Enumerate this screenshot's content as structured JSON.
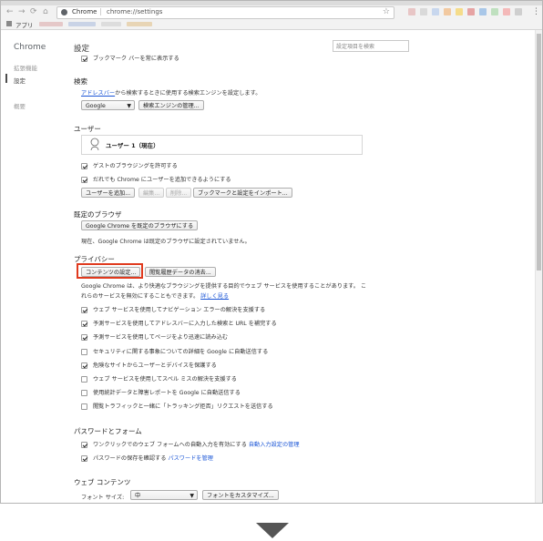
{
  "browser": {
    "site_label": "Chrome",
    "url": "chrome://settings",
    "apps_label": "アプリ"
  },
  "sidebar": {
    "title": "Chrome",
    "items": [
      {
        "label": "拡張機能"
      },
      {
        "label": "設定"
      },
      {
        "label": "概要"
      }
    ]
  },
  "header": {
    "title": "設定",
    "search_placeholder": "設定項目を検索"
  },
  "appearance": {
    "bookmark_bar": "ブックマーク バーを常に表示する"
  },
  "search_engine": {
    "title": "検索",
    "desc_link": "アドレスバー",
    "desc_rest": "から検索するときに使用する検索エンジンを設定します。",
    "selected": "Google",
    "manage_button": "検索エンジンの管理..."
  },
  "users": {
    "title": "ユーザー",
    "current_user": "ユーザー 1（現在）",
    "guest": "ゲストのブラウジングを許可する",
    "anyone_add": "だれでも Chrome にユーザーを追加できるようにする",
    "add_button": "ユーザーを追加...",
    "edit_button": "編集...",
    "delete_button": "削除...",
    "import_button": "ブックマークと設定をインポート..."
  },
  "default_browser": {
    "title": "既定のブラウザ",
    "button": "Google Chrome を既定のブラウザにする",
    "status": "現在、Google Chrome は既定のブラウザに設定されていません。"
  },
  "privacy": {
    "title": "プライバシー",
    "content_settings_button": "コンテンツの設定...",
    "clear_data_button": "閲覧履歴データの消去...",
    "desc_line1": "Google Chrome は、より快適なブラウジングを提供する目的でウェブ サービスを使用することがあります。 こ",
    "desc_line2": "れらのサービスを無効にすることもできます。",
    "learn_more": "詳しく見る",
    "options": [
      {
        "label": "ウェブ サービスを使用してナビゲーション エラーの解決を支援する",
        "checked": true
      },
      {
        "label": "予測サービスを使用してアドレスバーに入力した検索と URL を補完する",
        "checked": true
      },
      {
        "label": "予測サービスを使用してページをより迅速に読み込む",
        "checked": true
      },
      {
        "label": "セキュリティに関する事象についての詳細を Google に自動送信する",
        "checked": false
      },
      {
        "label": "危険なサイトからユーザーとデバイスを保護する",
        "checked": true
      },
      {
        "label": "ウェブ サービスを使用してスペル ミスの解決を支援する",
        "checked": false
      },
      {
        "label": "使用統計データと障害レポートを Google に自動送信する",
        "checked": false
      },
      {
        "label": "閲覧トラフィックと一緒に「トラッキング拒否」リクエストを送信する",
        "checked": false
      }
    ]
  },
  "passwords": {
    "title": "パスワードとフォーム",
    "autofill_text": "ワンクリックでのウェブ フォームへの自動入力を有効にする",
    "autofill_link": "自動入力設定の管理",
    "save_text": "パスワードの保存を確認する",
    "save_link": "パスワードを管理"
  },
  "web_content": {
    "title": "ウェブ コンテンツ",
    "font_size_label": "フォント サイズ:",
    "font_size_value": "中",
    "customize_button": "フォントをカスタマイズ..."
  },
  "colors": {
    "highlight": "#e03a1e",
    "link": "#1a55d6",
    "arrow": "#555555"
  }
}
